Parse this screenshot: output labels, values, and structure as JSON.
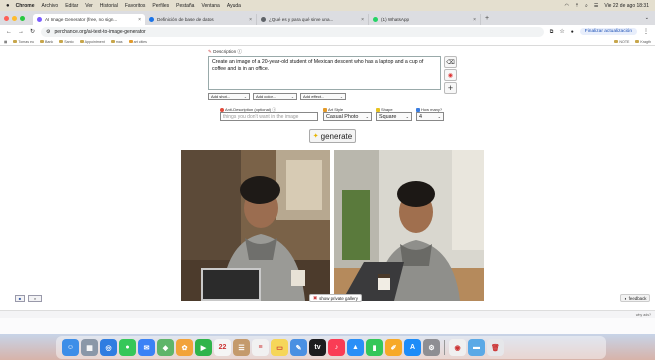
{
  "menubar": {
    "apple": "",
    "items": [
      "Chrome",
      "Archivo",
      "Editar",
      "Ver",
      "Historial",
      "Favoritos",
      "Perfiles",
      "Pestaña",
      "Ventana",
      "Ayuda"
    ],
    "datetime": "Vie 22 de ago 18:31"
  },
  "tabs": [
    {
      "title": "AI Image Generator (free, no sign...",
      "favicon_color": "#7b5cff"
    },
    {
      "title": "Definición de base de datos",
      "favicon_color": "#1a73e8"
    },
    {
      "title": "¿Qué es y para qué sirve una...",
      "favicon_color": "#5f6368"
    },
    {
      "title": "(1) WhatsApp",
      "favicon_color": "#25d366"
    }
  ],
  "addressbar": {
    "url": "perchance.org/ai-text-to-image-generator",
    "update_label": "Finalizar actualización"
  },
  "bookmarks": {
    "left": [
      "Tomas eu",
      "Bank",
      "Santo",
      "Appointment",
      "mas",
      "art cities"
    ],
    "right": [
      "NOTE",
      "Kragth"
    ]
  },
  "description": {
    "label": "Description ⓘ",
    "text": "Create an image of a 20-year-old student of Mexican descent who has a laptop and a cup of coffee and is in an office."
  },
  "selects": {
    "shot": "Add shot...",
    "color": "Add color...",
    "effect": "Add effect..."
  },
  "options": {
    "anti_label": "Anti-Description (optional) ⓘ",
    "anti_placeholder": "things you don't want in the image",
    "style_label": "Art Style",
    "style_value": "Casual Photo",
    "shape_label": "Shape",
    "shape_value": "Square",
    "count_label": "How many?",
    "count_value": "4"
  },
  "generate_label": "generate",
  "gallery_label": "show private gallery",
  "feedback_label": "feedback",
  "notice_text": "why ads?",
  "colors": {
    "accent": "#e6b400",
    "menubar": "#e4dfcf"
  },
  "dock_apps": [
    {
      "name": "finder",
      "color": "#3d8ee8",
      "glyph": "☺"
    },
    {
      "name": "launchpad",
      "color": "#8a97a8",
      "glyph": "▦"
    },
    {
      "name": "safari",
      "color": "#2f7de1",
      "glyph": "◎"
    },
    {
      "name": "messages",
      "color": "#35c759",
      "glyph": "●"
    },
    {
      "name": "mail",
      "color": "#3b82f6",
      "glyph": "✉"
    },
    {
      "name": "maps",
      "color": "#5fb56a",
      "glyph": "◆"
    },
    {
      "name": "photos",
      "color": "#f2a33a",
      "glyph": "✿"
    },
    {
      "name": "facetime",
      "color": "#2fb44a",
      "glyph": "▶"
    },
    {
      "name": "calendar",
      "color": "#f5f5f5",
      "glyph": "22"
    },
    {
      "name": "contacts",
      "color": "#c49a6c",
      "glyph": "☰"
    },
    {
      "name": "reminders",
      "color": "#f1f1f1",
      "glyph": "≡"
    },
    {
      "name": "notes",
      "color": "#f6d659",
      "glyph": "▭"
    },
    {
      "name": "freeform",
      "color": "#4a90e2",
      "glyph": "✎"
    },
    {
      "name": "tv",
      "color": "#1c1c1e",
      "glyph": "tv"
    },
    {
      "name": "music",
      "color": "#fa3c55",
      "glyph": "♪"
    },
    {
      "name": "keynote",
      "color": "#2a8ff7",
      "glyph": "▲"
    },
    {
      "name": "numbers",
      "color": "#34c759",
      "glyph": "▮"
    },
    {
      "name": "pages",
      "color": "#f7a928",
      "glyph": "✐"
    },
    {
      "name": "app-store",
      "color": "#1d8cf8",
      "glyph": "A"
    },
    {
      "name": "system-settings",
      "color": "#8e8e93",
      "glyph": "⚙"
    },
    {
      "name": "chrome",
      "color": "#f0f0f0",
      "glyph": "◉"
    },
    {
      "name": "folder",
      "color": "#5aa9e6",
      "glyph": "▬"
    },
    {
      "name": "trash",
      "color": "#e6e7ea",
      "glyph": "🗑"
    }
  ]
}
